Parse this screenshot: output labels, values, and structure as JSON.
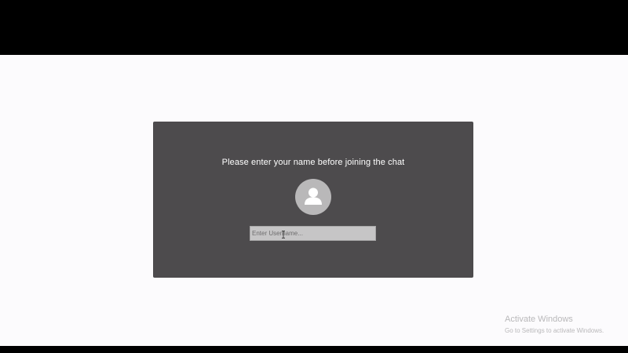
{
  "login": {
    "prompt": "Please enter your name before joining the chat",
    "avatar_icon": "user-icon",
    "username_input": {
      "placeholder": "Enter Username...",
      "value": ""
    }
  },
  "watermark": {
    "title": "Activate Windows",
    "subtitle": "Go to Settings to activate Windows."
  },
  "colors": {
    "card_background": "#4d4b4d",
    "page_background": "#fcfbfd",
    "avatar_background": "#b9b8b9",
    "input_background": "#c6c5c6"
  }
}
